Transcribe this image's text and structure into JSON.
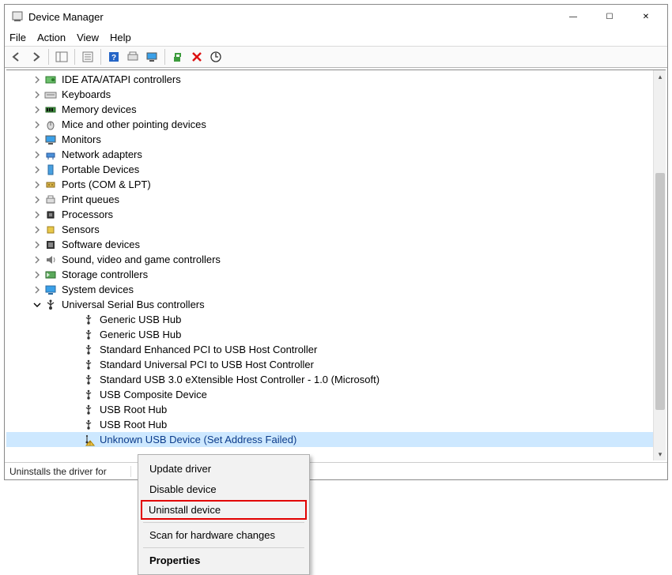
{
  "window": {
    "title": "Device Manager",
    "minimize": "—",
    "maximize": "☐",
    "close": "✕"
  },
  "menu": {
    "file": "File",
    "action": "Action",
    "view": "View",
    "help": "Help"
  },
  "tree": {
    "items": [
      {
        "label": "IDE ATA/ATAPI controllers",
        "icon": "hdd",
        "expanded": false
      },
      {
        "label": "Keyboards",
        "icon": "keyboard",
        "expanded": false
      },
      {
        "label": "Memory devices",
        "icon": "memory",
        "expanded": false
      },
      {
        "label": "Mice and other pointing devices",
        "icon": "mouse",
        "expanded": false
      },
      {
        "label": "Monitors",
        "icon": "monitor",
        "expanded": false
      },
      {
        "label": "Network adapters",
        "icon": "network",
        "expanded": false
      },
      {
        "label": "Portable Devices",
        "icon": "portable",
        "expanded": false
      },
      {
        "label": "Ports (COM & LPT)",
        "icon": "port",
        "expanded": false
      },
      {
        "label": "Print queues",
        "icon": "printer",
        "expanded": false
      },
      {
        "label": "Processors",
        "icon": "cpu",
        "expanded": false
      },
      {
        "label": "Sensors",
        "icon": "sensor",
        "expanded": false
      },
      {
        "label": "Software devices",
        "icon": "software",
        "expanded": false
      },
      {
        "label": "Sound, video and game controllers",
        "icon": "sound",
        "expanded": false
      },
      {
        "label": "Storage controllers",
        "icon": "storage",
        "expanded": false
      },
      {
        "label": "System devices",
        "icon": "system",
        "expanded": false
      },
      {
        "label": "Universal Serial Bus controllers",
        "icon": "usb-ctrl",
        "expanded": true
      }
    ],
    "usb_children": [
      {
        "label": "Generic USB Hub",
        "icon": "usb"
      },
      {
        "label": "Generic USB Hub",
        "icon": "usb"
      },
      {
        "label": "Standard Enhanced PCI to USB Host Controller",
        "icon": "usb"
      },
      {
        "label": "Standard Universal PCI to USB Host Controller",
        "icon": "usb"
      },
      {
        "label": "Standard USB 3.0 eXtensible Host Controller - 1.0 (Microsoft)",
        "icon": "usb"
      },
      {
        "label": "USB Composite Device",
        "icon": "usb"
      },
      {
        "label": "USB Root Hub",
        "icon": "usb"
      },
      {
        "label": "USB Root Hub",
        "icon": "usb"
      },
      {
        "label": "Unknown USB Device (Set Address Failed)",
        "icon": "usb-warn",
        "selected": true
      }
    ]
  },
  "context_menu": {
    "update": "Update driver",
    "disable": "Disable device",
    "uninstall": "Uninstall device",
    "scan": "Scan for hardware changes",
    "properties": "Properties"
  },
  "status": {
    "text": "Uninstalls the driver for"
  }
}
